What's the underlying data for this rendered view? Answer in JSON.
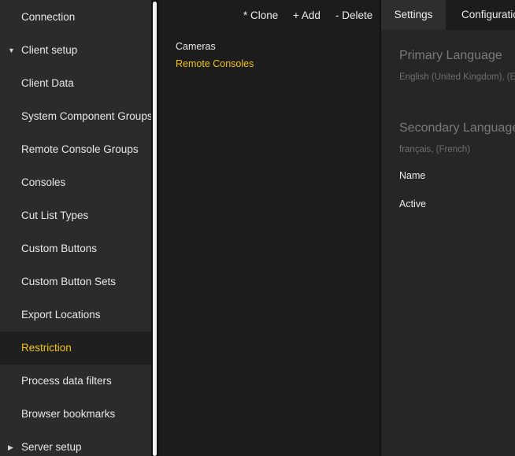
{
  "sidebar": {
    "items": [
      {
        "label": "Connection"
      },
      {
        "label": "Client setup",
        "expander": "▼"
      },
      {
        "label": "Client Data"
      },
      {
        "label": "System Component Groups"
      },
      {
        "label": "Remote Console Groups"
      },
      {
        "label": "Consoles"
      },
      {
        "label": "Cut List Types"
      },
      {
        "label": "Custom Buttons"
      },
      {
        "label": "Custom Button Sets"
      },
      {
        "label": "Export Locations"
      },
      {
        "label": "Restriction"
      },
      {
        "label": "Process data filters"
      },
      {
        "label": "Browser bookmarks"
      },
      {
        "label": "Server setup",
        "expander": "▶"
      }
    ]
  },
  "toolbar": {
    "clone_label": "* Clone",
    "add_label": "+ Add",
    "delete_label": "- Delete"
  },
  "list": {
    "items": [
      "Cameras",
      "Remote Consoles"
    ]
  },
  "tabs": {
    "settings": "Settings",
    "configuration": "Configuration"
  },
  "details": {
    "primary_language": {
      "title": "Primary Language",
      "value": "English (United Kingdom), (English (United Kingdom))"
    },
    "secondary_language": {
      "title": "Secondary Language",
      "value": "français, (French)"
    },
    "fields": {
      "name": "Name",
      "active": "Active"
    }
  },
  "colors": {
    "accent": "#f0c419",
    "sidebar_bg": "#2b2b2b",
    "content_bg": "#1c1c1c",
    "details_bg": "#262626"
  }
}
